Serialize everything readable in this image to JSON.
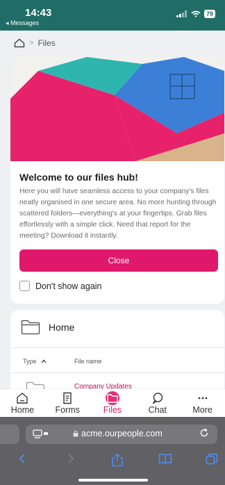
{
  "status": {
    "time": "14:43",
    "back_label": "◂ Messages",
    "battery": "79"
  },
  "breadcrumb": {
    "current": "Files"
  },
  "welcome": {
    "title": "Welcome to our files hub!",
    "body": "Here you will have seamless access to your company's files neatly organised in one secure area. No more hunting through scattered folders—everything's at your fingertips. Grab files effortlessly with a simple click. Need that report for the meeting? Download it instantly.",
    "close_label": "Close",
    "dont_show_label": "Don't show again"
  },
  "home_card": {
    "title": "Home",
    "columns": {
      "type": "Type",
      "name": "File name"
    },
    "rows": [
      {
        "name": "Company Updates"
      }
    ]
  },
  "tabbar": {
    "items": [
      {
        "label": "Home",
        "icon": "home-icon"
      },
      {
        "label": "Forms",
        "icon": "document-icon"
      },
      {
        "label": "Files",
        "icon": "folder-icon"
      },
      {
        "label": "Chat",
        "icon": "chat-icon"
      },
      {
        "label": "More",
        "icon": "more-icon"
      }
    ],
    "active_color": "#e0186c"
  },
  "browser": {
    "url": "acme.ourpeople.com"
  },
  "colors": {
    "accent": "#e0186c",
    "status_bar": "#1f6d66"
  }
}
